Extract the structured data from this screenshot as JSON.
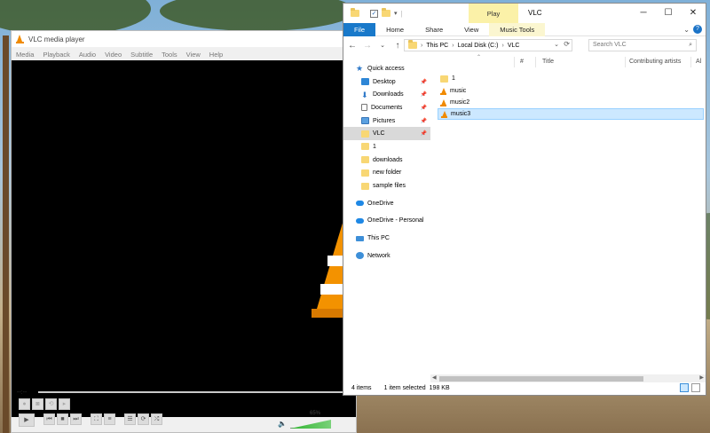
{
  "vlc": {
    "title": "VLC media player",
    "menu": [
      "Media",
      "Playback",
      "Audio",
      "Video",
      "Subtitle",
      "Tools",
      "View",
      "Help"
    ],
    "time": "--:--",
    "volume": "65%"
  },
  "explorer": {
    "ribbon_context": "Play",
    "window_title": "VLC",
    "tabs": {
      "file": "File",
      "home": "Home",
      "share": "Share",
      "view": "View",
      "music_tools": "Music Tools"
    },
    "breadcrumb": [
      "This PC",
      "Local Disk (C:)",
      "VLC"
    ],
    "search_placeholder": "Search VLC",
    "nav": [
      {
        "label": "Quick access",
        "icon": "star-icon"
      },
      {
        "label": "Desktop",
        "icon": "desktop-icon",
        "pinned": true
      },
      {
        "label": "Downloads",
        "icon": "downloads-icon",
        "pinned": true
      },
      {
        "label": "Documents",
        "icon": "documents-icon",
        "pinned": true
      },
      {
        "label": "Pictures",
        "icon": "pictures-icon",
        "pinned": true
      },
      {
        "label": "VLC",
        "icon": "folder-icon",
        "pinned": true,
        "selected": true
      },
      {
        "label": "1",
        "icon": "folder-icon"
      },
      {
        "label": "downloads",
        "icon": "folder-icon"
      },
      {
        "label": "new folder",
        "icon": "folder-icon"
      },
      {
        "label": "sample files",
        "icon": "folder-icon"
      },
      {
        "label": "OneDrive",
        "icon": "cloud-icon"
      },
      {
        "label": "OneDrive - Personal",
        "icon": "cloud-icon"
      },
      {
        "label": "This PC",
        "icon": "pc-icon"
      },
      {
        "label": "Network",
        "icon": "network-icon"
      }
    ],
    "columns": [
      "#",
      "Title",
      "Contributing artists",
      "Al"
    ],
    "files": [
      {
        "name": "1",
        "type": "folder"
      },
      {
        "name": "music",
        "type": "vlc"
      },
      {
        "name": "music2",
        "type": "vlc"
      },
      {
        "name": "music3",
        "type": "vlc",
        "selected": true
      }
    ],
    "status": {
      "count": "4 items",
      "selected": "1 item selected",
      "size": "198 KB"
    }
  }
}
